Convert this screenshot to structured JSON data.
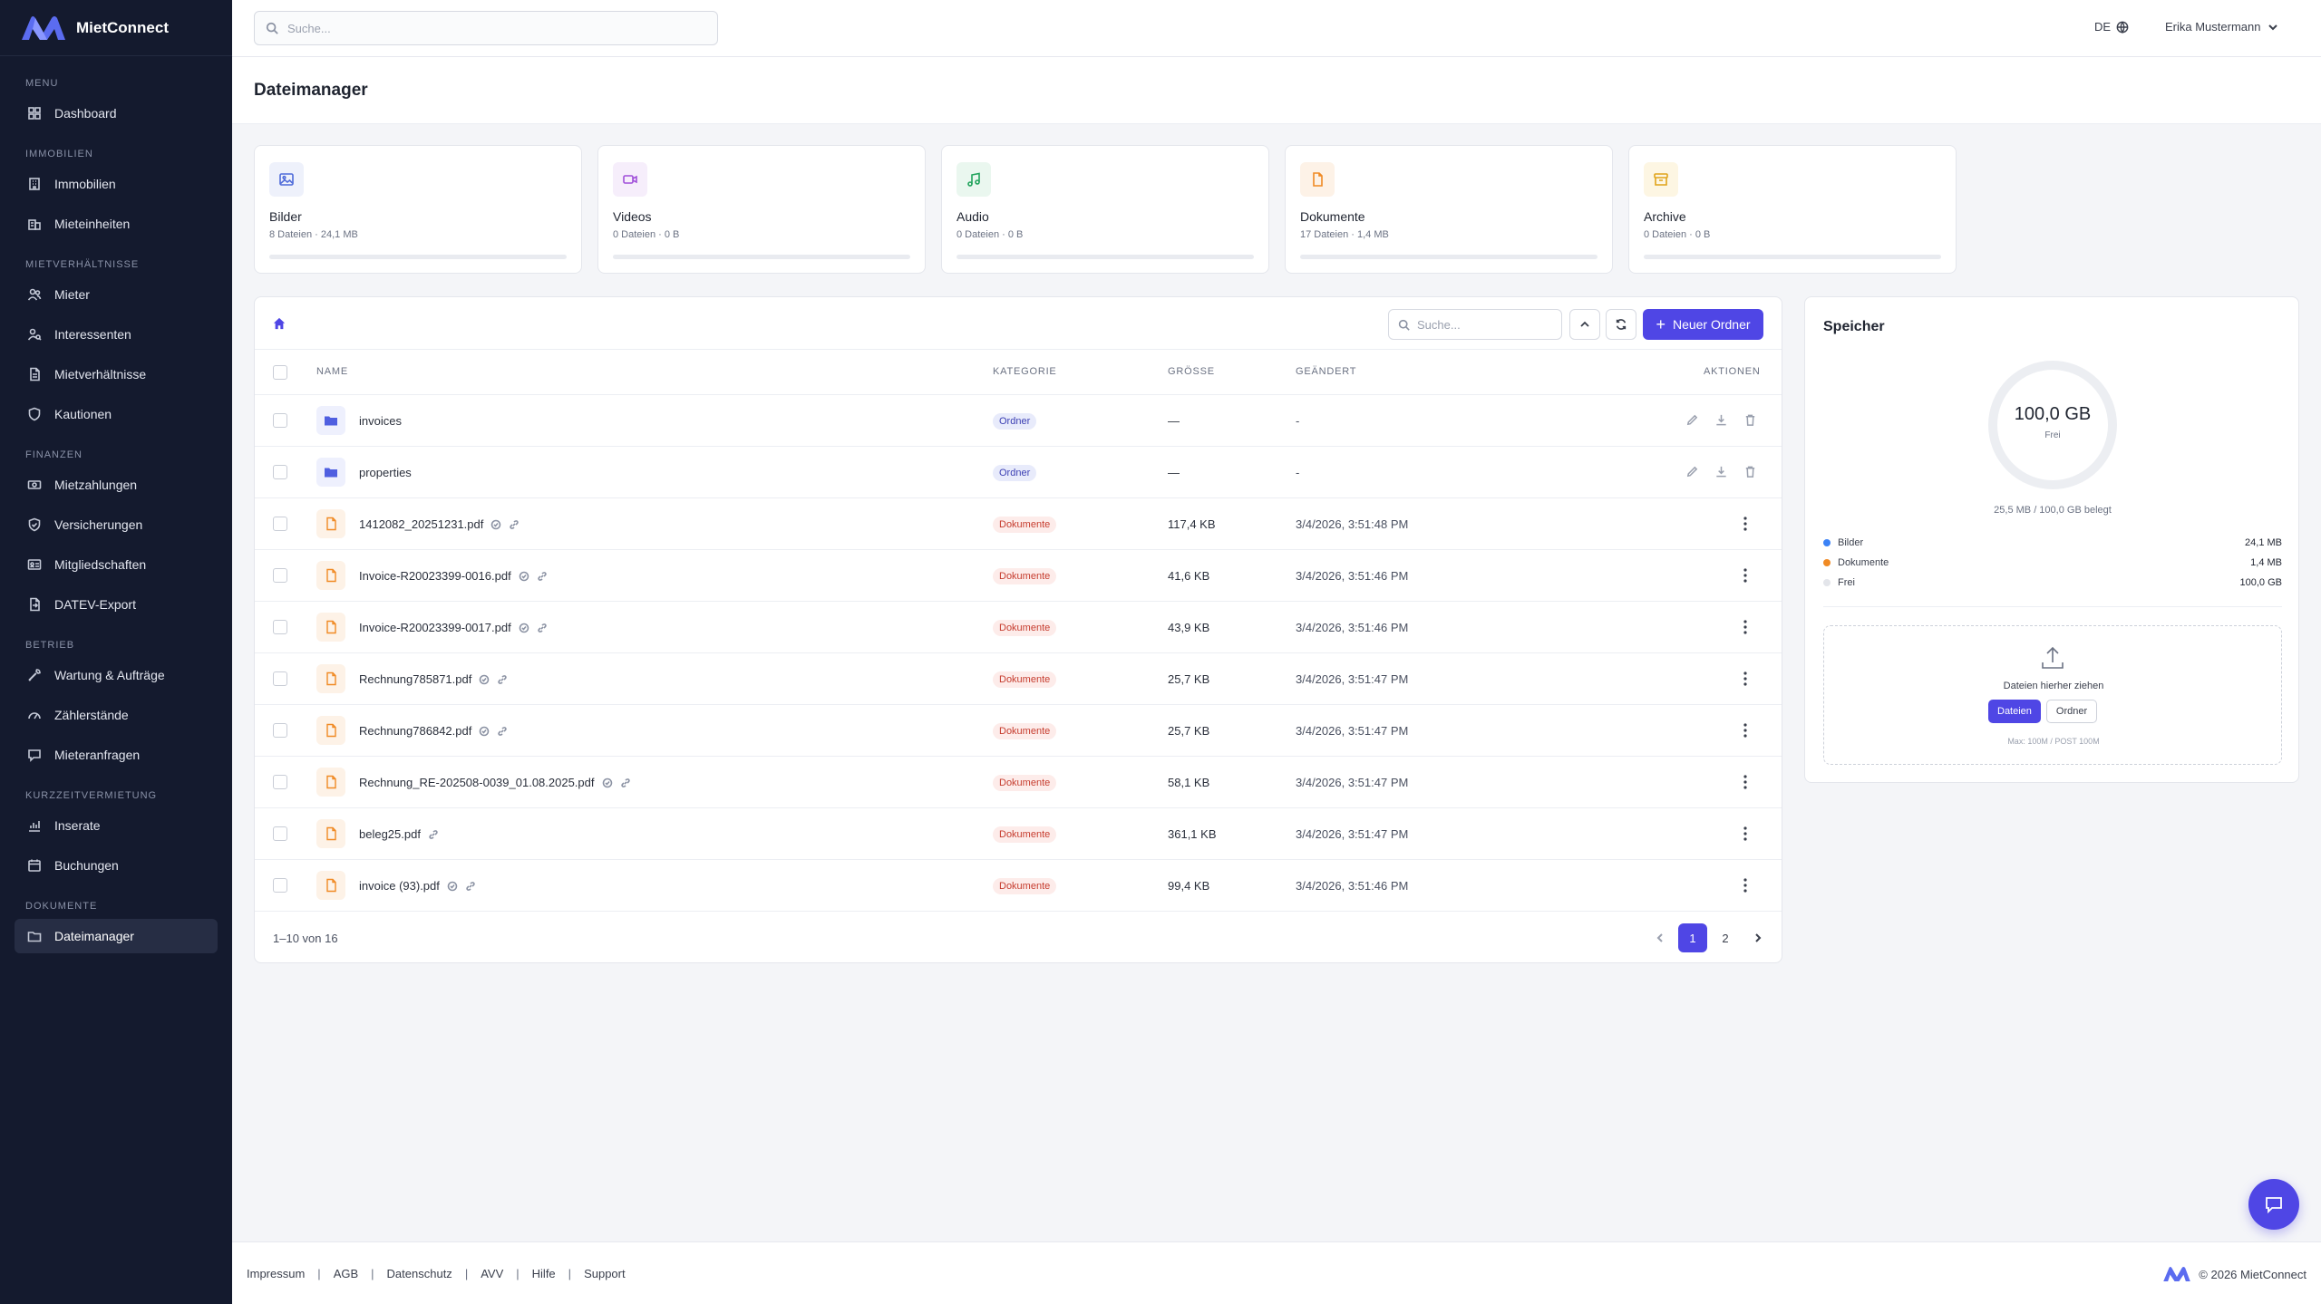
{
  "brand": {
    "name": "MietConnect"
  },
  "search": {
    "placeholder": "Suche..."
  },
  "topbar": {
    "language": "DE",
    "user": "Erika Mustermann"
  },
  "sidebar": {
    "sections": [
      {
        "title": "Menu",
        "items": [
          {
            "label": "Dashboard",
            "icon": "grid-icon"
          }
        ]
      },
      {
        "title": "Immobilien",
        "items": [
          {
            "label": "Immobilien",
            "icon": "building-icon"
          },
          {
            "label": "Mieteinheiten",
            "icon": "building-units-icon"
          }
        ]
      },
      {
        "title": "Mietverhältnisse",
        "items": [
          {
            "label": "Mieter",
            "icon": "users-icon"
          },
          {
            "label": "Interessenten",
            "icon": "user-search-icon"
          },
          {
            "label": "Mietverhältnisse",
            "icon": "document-icon"
          },
          {
            "label": "Kautionen",
            "icon": "shield-icon"
          }
        ]
      },
      {
        "title": "Finanzen",
        "items": [
          {
            "label": "Mietzahlungen",
            "icon": "banknote-icon"
          },
          {
            "label": "Versicherungen",
            "icon": "shield-check-icon"
          },
          {
            "label": "Mitgliedschaften",
            "icon": "id-card-icon"
          },
          {
            "label": "DATEV-Export",
            "icon": "file-export-icon"
          }
        ]
      },
      {
        "title": "Betrieb",
        "items": [
          {
            "label": "Wartung & Aufträge",
            "icon": "wrench-icon"
          },
          {
            "label": "Zählerstände",
            "icon": "gauge-icon"
          },
          {
            "label": "Mieteranfragen",
            "icon": "message-icon"
          }
        ]
      },
      {
        "title": "Kurzzeitvermietung",
        "items": [
          {
            "label": "Inserate",
            "icon": "chart-icon"
          },
          {
            "label": "Buchungen",
            "icon": "calendar-icon"
          }
        ]
      },
      {
        "title": "Dokumente",
        "items": [
          {
            "label": "Dateimanager",
            "icon": "folder-icon",
            "active": true
          }
        ]
      }
    ]
  },
  "page": {
    "title": "Dateimanager"
  },
  "categories": [
    {
      "title": "Bilder",
      "sub": "8 Dateien · 24,1 MB",
      "icon": "image-icon",
      "color": "#4f6bd9",
      "bg": "#eef1fb",
      "fill": 0.0
    },
    {
      "title": "Videos",
      "sub": "0 Dateien · 0 B",
      "icon": "video-icon",
      "color": "#a04fd9",
      "bg": "#f6eefb",
      "fill": 0.0
    },
    {
      "title": "Audio",
      "sub": "0 Dateien · 0 B",
      "icon": "music-icon",
      "color": "#22a45d",
      "bg": "#eaf7ef",
      "fill": 0.0
    },
    {
      "title": "Dokumente",
      "sub": "17 Dateien · 1,4 MB",
      "icon": "document-icon",
      "color": "#f08a24",
      "bg": "#fdf2e7",
      "fill": 0.0
    },
    {
      "title": "Archive",
      "sub": "0 Dateien · 0 B",
      "icon": "archive-icon",
      "color": "#e0a41a",
      "bg": "#fdf6e3",
      "fill": 0.0
    }
  ],
  "files": {
    "search_placeholder": "Suche...",
    "new_folder_label": "Neuer Ordner",
    "columns": {
      "name": "Name",
      "category": "Kategorie",
      "size": "Größe",
      "modified": "Geändert",
      "actions": "Aktionen"
    },
    "rows": [
      {
        "name": "invoices",
        "type": "folder",
        "category": "Ordner",
        "size": "—",
        "modified": "-"
      },
      {
        "name": "properties",
        "type": "folder",
        "category": "Ordner",
        "size": "—",
        "modified": "-"
      },
      {
        "name": "1412082_20251231.pdf",
        "type": "file",
        "category": "Dokumente",
        "size": "117,4 KB",
        "modified": "3/4/2026, 3:51:48 PM"
      },
      {
        "name": "Invoice-R20023399-0016.pdf",
        "type": "file",
        "category": "Dokumente",
        "size": "41,6 KB",
        "modified": "3/4/2026, 3:51:46 PM"
      },
      {
        "name": "Invoice-R20023399-0017.pdf",
        "type": "file",
        "category": "Dokumente",
        "size": "43,9 KB",
        "modified": "3/4/2026, 3:51:46 PM"
      },
      {
        "name": "Rechnung785871.pdf",
        "type": "file",
        "category": "Dokumente",
        "size": "25,7 KB",
        "modified": "3/4/2026, 3:51:47 PM"
      },
      {
        "name": "Rechnung786842.pdf",
        "type": "file",
        "category": "Dokumente",
        "size": "25,7 KB",
        "modified": "3/4/2026, 3:51:47 PM"
      },
      {
        "name": "Rechnung_RE-202508-0039_01.08.2025.pdf",
        "type": "file",
        "category": "Dokumente",
        "size": "58,1 KB",
        "modified": "3/4/2026, 3:51:47 PM"
      },
      {
        "name": "beleg25.pdf",
        "type": "file",
        "category": "Dokumente",
        "size": "361,1 KB",
        "modified": "3/4/2026, 3:51:47 PM",
        "no_check": true
      },
      {
        "name": "invoice (93).pdf",
        "type": "file",
        "category": "Dokumente",
        "size": "99,4 KB",
        "modified": "3/4/2026, 3:51:46 PM"
      }
    ],
    "range": "1–10 von 16",
    "pages": [
      "1",
      "2"
    ],
    "current_page": "1"
  },
  "storage": {
    "title": "Speicher",
    "free_value": "100,0 GB",
    "free_label": "Frei",
    "used_text": "25,5 MB / 100,0 GB belegt",
    "legend": [
      {
        "label": "Bilder",
        "value": "24,1 MB",
        "color": "#3b82f6"
      },
      {
        "label": "Dokumente",
        "value": "1,4 MB",
        "color": "#f08a24"
      },
      {
        "label": "Frei",
        "value": "100,0 GB",
        "color": "#e3e5ea"
      }
    ],
    "drop_text": "Dateien hierher ziehen",
    "btn_files": "Dateien",
    "btn_folder": "Ordner",
    "hint": "Max: 100M / POST 100M"
  },
  "footer": {
    "links": [
      "Impressum",
      "AGB",
      "Datenschutz",
      "AVV",
      "Hilfe",
      "Support"
    ],
    "copyright": "© 2026 MietConnect"
  },
  "colors": {
    "accent": "#4f46e5",
    "sidebar_bg": "#141a2e"
  }
}
